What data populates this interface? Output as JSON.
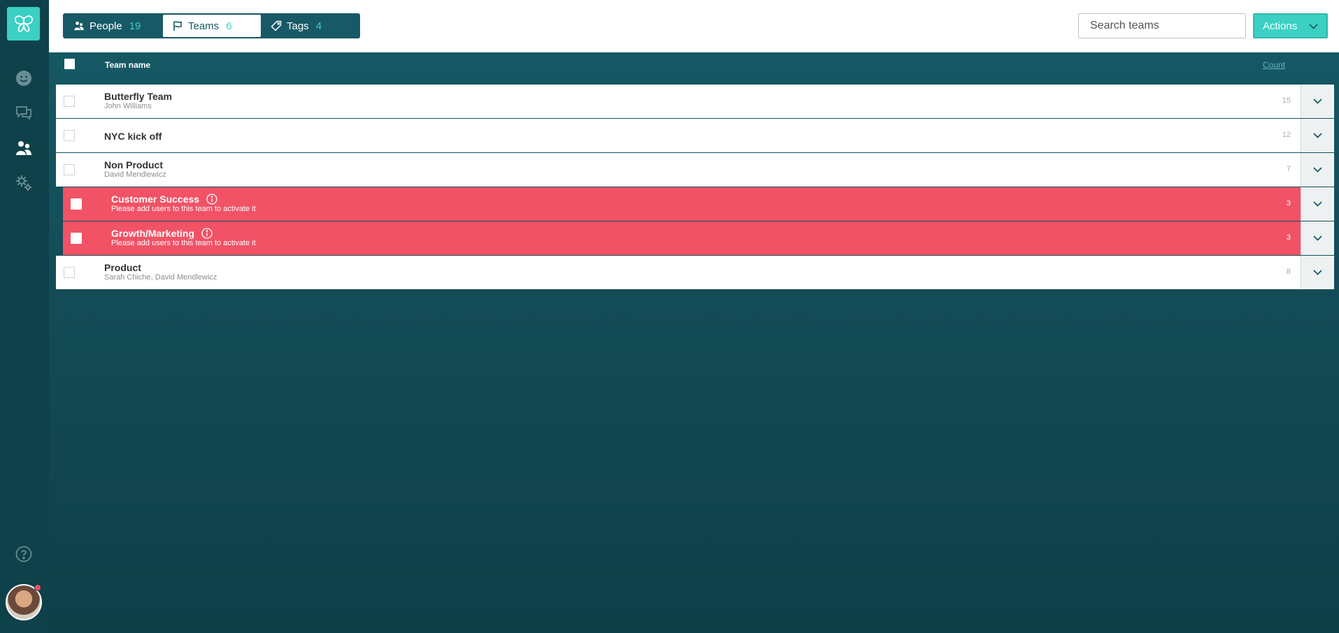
{
  "nav": {
    "logo_icon": "butterfly-logo",
    "items": [
      {
        "name": "smiley-icon",
        "active": false
      },
      {
        "name": "chat-bubbles-icon",
        "active": false
      },
      {
        "name": "people-icon",
        "active": true
      },
      {
        "name": "gears-icon",
        "active": false
      }
    ],
    "help_icon": "help-icon",
    "avatar_status_color": "#f0536a"
  },
  "topbar": {
    "tabs": [
      {
        "label": "People",
        "count": "19",
        "icon": "people-icon",
        "active": false
      },
      {
        "label": "Teams",
        "count": "6",
        "icon": "flag-icon",
        "active": true
      },
      {
        "label": "Tags",
        "count": "4",
        "icon": "tag-icon",
        "active": false
      }
    ],
    "search_placeholder": "Search teams",
    "actions_label": "Actions"
  },
  "table": {
    "header": {
      "name": "Team name",
      "count": "Count"
    },
    "rows": [
      {
        "name": "Butterfly Team",
        "sub": "John Williams",
        "count": "15",
        "error": false
      },
      {
        "name": "NYC kick off",
        "sub": "",
        "count": "12",
        "error": false
      },
      {
        "name": "Non Product",
        "sub": "David Mendlewicz",
        "count": "7",
        "error": false
      },
      {
        "name": "Customer Success",
        "sub": "Please add users to this team to activate it",
        "count": "3",
        "error": true
      },
      {
        "name": "Growth/Marketing",
        "sub": "Please add users to this team to activate it",
        "count": "3",
        "error": true
      },
      {
        "name": "Product",
        "sub": "Sarah Chiche, David Mendlewicz",
        "count": "8",
        "error": false
      }
    ]
  },
  "colors": {
    "accent": "#3bd0c3",
    "header_bg": "#175966",
    "error_row": "#f15266"
  }
}
